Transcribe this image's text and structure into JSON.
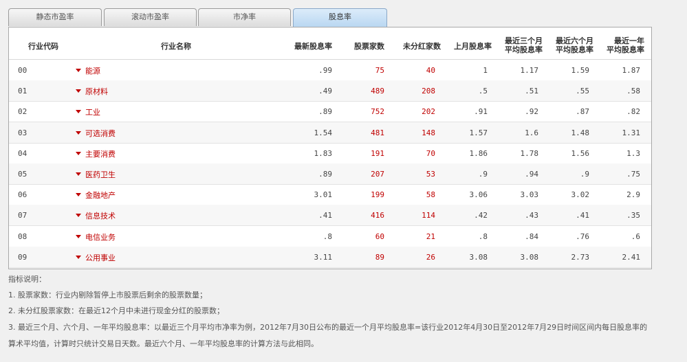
{
  "tabs": [
    {
      "label": "静态市盈率",
      "active": false
    },
    {
      "label": "滚动市盈率",
      "active": false
    },
    {
      "label": "市净率",
      "active": false
    },
    {
      "label": "股息率",
      "active": true
    }
  ],
  "table": {
    "headers": {
      "code": "行业代码",
      "name": "行业名称",
      "latest_yield": "最新股息率",
      "stock_count": "股票家数",
      "no_dividend": "未分红家数",
      "last_month": "上月股息率",
      "avg3_l1": "最近三个月",
      "avg3_l2": "平均股息率",
      "avg6_l1": "最近六个月",
      "avg6_l2": "平均股息率",
      "avg12_l1": "最近一年",
      "avg12_l2": "平均股息率"
    },
    "rows": [
      {
        "code": "00",
        "name": "能源",
        "latest": ".99",
        "count": "75",
        "nodiv": "40",
        "last": "1",
        "a3": "1.17",
        "a6": "1.59",
        "a12": "1.87"
      },
      {
        "code": "01",
        "name": "原材料",
        "latest": ".49",
        "count": "489",
        "nodiv": "208",
        "last": ".5",
        "a3": ".51",
        "a6": ".55",
        "a12": ".58"
      },
      {
        "code": "02",
        "name": "工业",
        "latest": ".89",
        "count": "752",
        "nodiv": "202",
        "last": ".91",
        "a3": ".92",
        "a6": ".87",
        "a12": ".82"
      },
      {
        "code": "03",
        "name": "可选消费",
        "latest": "1.54",
        "count": "481",
        "nodiv": "148",
        "last": "1.57",
        "a3": "1.6",
        "a6": "1.48",
        "a12": "1.31"
      },
      {
        "code": "04",
        "name": "主要消费",
        "latest": "1.83",
        "count": "191",
        "nodiv": "70",
        "last": "1.86",
        "a3": "1.78",
        "a6": "1.56",
        "a12": "1.3"
      },
      {
        "code": "05",
        "name": "医药卫生",
        "latest": ".89",
        "count": "207",
        "nodiv": "53",
        "last": ".9",
        "a3": ".94",
        "a6": ".9",
        "a12": ".75"
      },
      {
        "code": "06",
        "name": "金融地产",
        "latest": "3.01",
        "count": "199",
        "nodiv": "58",
        "last": "3.06",
        "a3": "3.03",
        "a6": "3.02",
        "a12": "2.9"
      },
      {
        "code": "07",
        "name": "信息技术",
        "latest": ".41",
        "count": "416",
        "nodiv": "114",
        "last": ".42",
        "a3": ".43",
        "a6": ".41",
        "a12": ".35"
      },
      {
        "code": "08",
        "name": "电信业务",
        "latest": ".8",
        "count": "60",
        "nodiv": "21",
        "last": ".8",
        "a3": ".84",
        "a6": ".76",
        "a12": ".6"
      },
      {
        "code": "09",
        "name": "公用事业",
        "latest": "3.11",
        "count": "89",
        "nodiv": "26",
        "last": "3.08",
        "a3": "3.08",
        "a6": "2.73",
        "a12": "2.41"
      }
    ]
  },
  "notes": {
    "title": "指标说明：",
    "n1": "1. 股票家数：行业内剔除暂停上市股票后剩余的股票数量；",
    "n2": "2. 未分红股票家数：在最近12个月中未进行现金分红的股票数；",
    "n3a": "3. 最近三个月、六个月、一年平均股息率：以最近三个月平均市净率为例，2012年7月30日公布的最近一个月平均股息率=该行业2012年4月30日至2012年7月29日时间区间内每日股息率的",
    "n3b": "算术平均值，计算时只统计交易日天数。最近六个月、一年平均股息率的计算方法与此相同。"
  },
  "colors": {
    "red": "#c00000",
    "active_tab": "#b8d6f1"
  }
}
